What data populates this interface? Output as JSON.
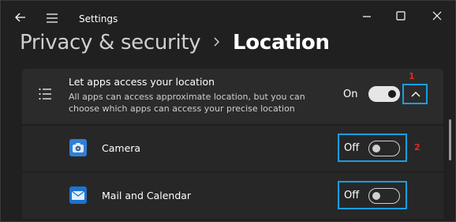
{
  "titlebar": {
    "title": "Settings",
    "icons": [
      "back-arrow-icon",
      "hamburger-menu-icon",
      "minimize-icon",
      "maximize-icon",
      "close-icon"
    ]
  },
  "breadcrumb": {
    "parent": "Privacy & security",
    "current": "Location"
  },
  "location_setting": {
    "title": "Let apps access your location",
    "description": "All apps can access approximate location, but you can choose which apps can access your precise location",
    "state": "On",
    "toggle_on": true,
    "annotation": "1"
  },
  "apps": [
    {
      "label": "Camera",
      "state": "Off",
      "toggle_on": false,
      "annotation": "2",
      "icon": "camera-icon"
    },
    {
      "label": "Mail and Calendar",
      "state": "Off",
      "toggle_on": false,
      "icon": "mail-icon"
    }
  ],
  "colors": {
    "accent": "#1a9ee0",
    "annotation": "#e8252b",
    "background": "#202020",
    "card": "#2b2b2b"
  }
}
